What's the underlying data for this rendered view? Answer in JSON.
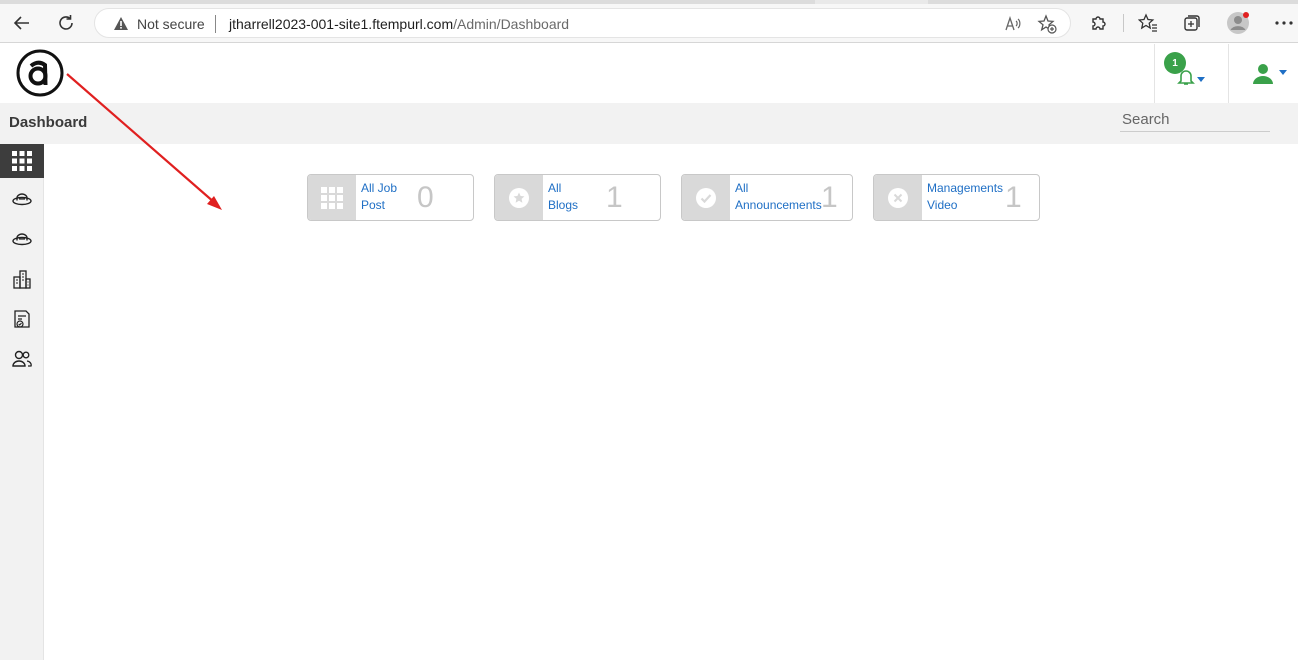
{
  "browser": {
    "not_secure_label": "Not secure",
    "url_host": "jtharrell2023-001-site1.ftempurl.com",
    "url_path": "/Admin/Dashboard"
  },
  "header": {
    "notification_count": "1"
  },
  "title_bar": {
    "page_title": "Dashboard",
    "search_placeholder": "Search"
  },
  "sidebar": {
    "items": [
      {
        "icon": "grid-icon",
        "active": true
      },
      {
        "icon": "hat-icon",
        "active": false
      },
      {
        "icon": "hat-icon",
        "active": false
      },
      {
        "icon": "buildings-icon",
        "active": false
      },
      {
        "icon": "document-check-icon",
        "active": false
      },
      {
        "icon": "users-icon",
        "active": false
      }
    ]
  },
  "cards": [
    {
      "icon": "grid-icon",
      "label_line1": "All Job",
      "label_line2": "Post",
      "count": "0"
    },
    {
      "icon": "star-icon",
      "label_line1": "All",
      "label_line2": "Blogs",
      "count": "1"
    },
    {
      "icon": "check-icon",
      "label_line1": "All",
      "label_line2": "Announcements",
      "count": "1"
    },
    {
      "icon": "close-icon",
      "label_line1": "Managements",
      "label_line2": "Video",
      "count": "1"
    }
  ],
  "colors": {
    "accent_green": "#3aa14a",
    "link_blue": "#1f6fc5",
    "annotation_red": "#e02020"
  }
}
